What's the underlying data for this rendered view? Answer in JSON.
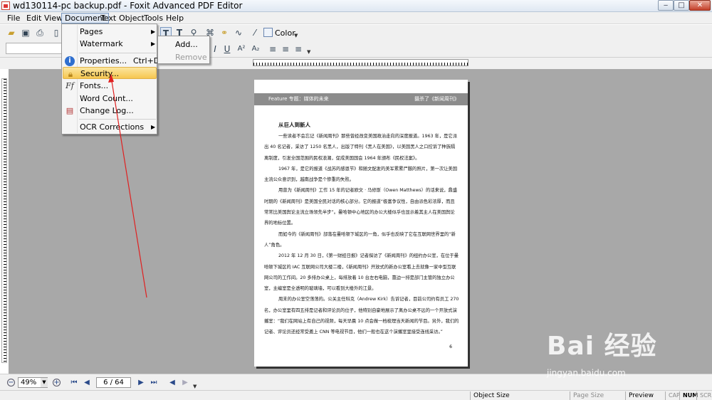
{
  "window": {
    "title": "wd130114-pc backup.pdf - Foxit Advanced PDF Editor",
    "minimize": "‒",
    "maximize": "□",
    "close": "✕"
  },
  "menubar": {
    "items": [
      "File",
      "Edit",
      "View",
      "Document",
      "Text",
      "Object",
      "Tools",
      "Help"
    ],
    "active": "Document"
  },
  "document_menu": {
    "items": [
      {
        "label": "Pages",
        "submenu": true
      },
      {
        "label": "Watermark",
        "submenu": true
      },
      {
        "label": "Properties...",
        "shortcut": "Ctrl+D",
        "icon": "info-icon"
      },
      {
        "label": "Security...",
        "icon": "lock-icon",
        "highlighted": true
      },
      {
        "label": "Fonts...",
        "icon": "font-icon"
      },
      {
        "label": "Word Count..."
      },
      {
        "label": "Change Log...",
        "icon": "change-log-icon"
      },
      {
        "label": "OCR Corrections",
        "submenu": true
      }
    ],
    "arrow_glyph": "▶"
  },
  "watermark_submenu": {
    "items": [
      {
        "label": "Add...",
        "enabled": true
      },
      {
        "label": "Remove",
        "enabled": false
      }
    ]
  },
  "toolbar": {
    "color_label": "Color"
  },
  "page": {
    "header_left": "Feature  专题：媒体的未来",
    "header_right": "摄杀了《新闻周刊》",
    "headline": "从巨人到新人",
    "paragraphs": [
      "一些读者不会忘记《新闻周刊》那些曾经改变美国政治走向的深度报道。1963 年，是它派出 40 名记者，采访了 1250 名黑人，出版了特刊《黑人在美国》，以美国黑人之口控诉了种族隔离制度，引发全国范围的民权浪潮，促成美国国会 1964 年颁布《民权法案》。",
      "1967 年，是它的报道《战苏的感恩节》和随文配发的美军累累尸骸的照片，第一次让美国主流公众意识到，越南战争是个惨重的失败。",
      "用曾为《新闻周刊》工作 15 年的记者欧文 · 马修斯（Owen Matthews）的话来说，鼎盛时期的《新闻周刊》是美国全民对话的核心部分。它的报道“极富争议性，自由派色彩浓厚，而且常常比美国舆论主流立场领先半步”。曼哈顿中心地区的办公大楼似乎也显示着其主人在美国舆论界的地标位置。",
      "而如今的《新闻周刊》部落在曼哈顿下城区的一角，似乎也反映了它在互联网世界里的“新人”角色。",
      "2012 年 12 月 30 日，《第一财经日报》记者探访了《新闻周刊》的纽约办公室，在位于曼哈顿下城区的 IAC 互联网公司大楼二楼，《新闻周刊》开放式的新办公室看上去就像一家中型互联网公司的工作间。20 多排办公桌上，每排放着 10 台左右电脑，靠边一排是部门主管的独立办公室，主编室是全透明的玻璃墙，可以看到大楼外的江景。",
      "周末的办公室空荡荡的。公关主任科克（Andrew Kirk）告诉记者，目前公司约有员工 270 名，办公室里有四五排是记者和评论员的位子，他特别自豪地展示了离办公桌不远的一个开放式演播室：“我们在网站上有自己的视频，每天早晨 10 点会做一档梳理当天新闻的节目。另外，我们的记者、评论员还经常受邀上 CNN 等电视节目，他们一般也在这个演播室里接受连线采访。”"
    ],
    "page_number": "6"
  },
  "navbar": {
    "zoom": "49%",
    "page_indicator": "6 / 64"
  },
  "statusbar": {
    "object_size_label": "Object Size",
    "page_size_label": "Page Size",
    "preview_label": "Preview",
    "cap": "CAP",
    "num": "NUM",
    "scrl": "SCRL"
  },
  "watermark": {
    "brand": "Bai 经验",
    "url": "jingyan.baidu.com"
  },
  "colors": {
    "workspace": "#a8a8a8",
    "highlight": "#f6c650",
    "annotation_arrow": "#e02020"
  }
}
